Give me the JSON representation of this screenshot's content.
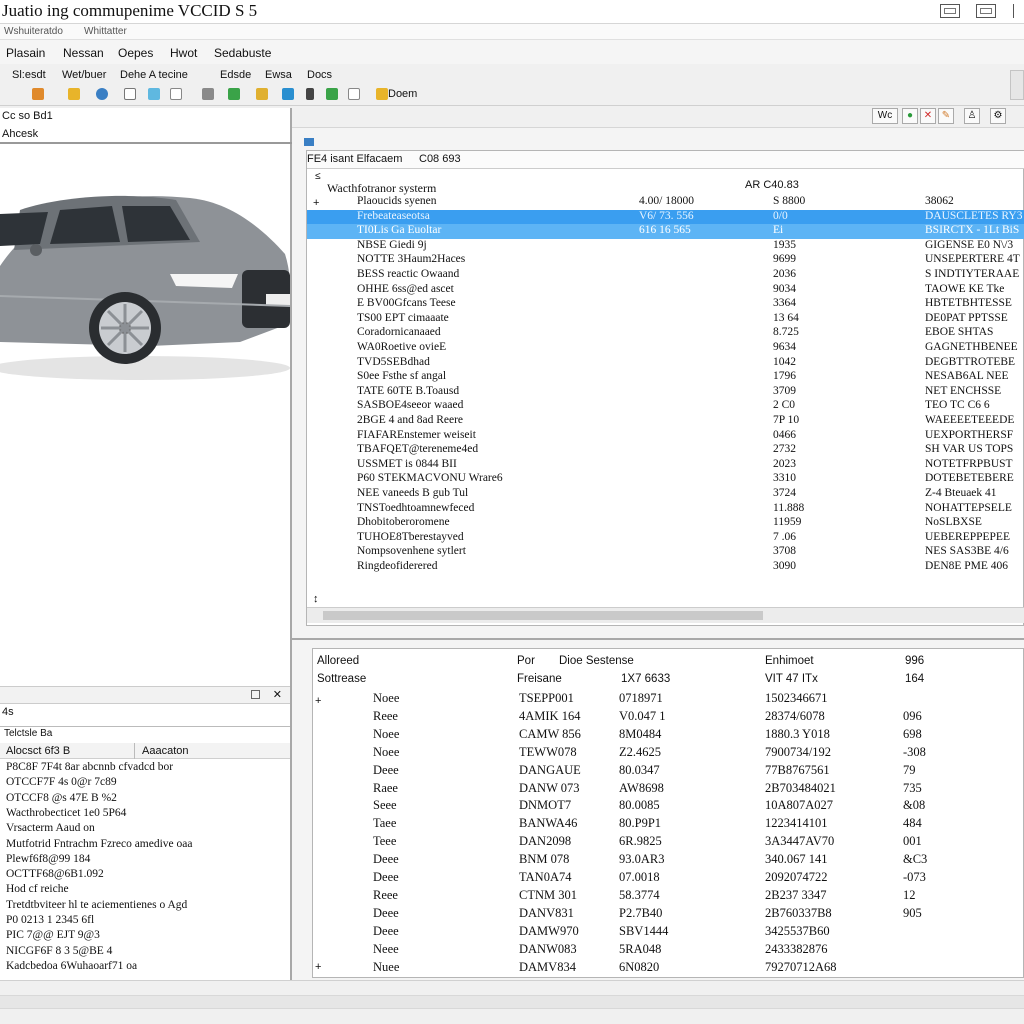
{
  "window": {
    "title": "Juatio ing commupenime VCCID S 5",
    "subtabs": [
      "Wshuiteratdo",
      "Whittatter"
    ]
  },
  "menu": [
    "Plasain",
    "Nessan",
    "Oepes",
    "Hwot",
    "Sedabuste"
  ],
  "toolbar_labels": [
    "Sl:esdt",
    "Wet/buer",
    "Dehe A tecine",
    "Edsde",
    "Ewsa",
    "Docs"
  ],
  "toolbar2": {
    "button_label": "Doem"
  },
  "left_panel": {
    "header_line1": "Cc so Bd1",
    "header_line2": "Ahcesk",
    "split_tag": "4s",
    "list_title": "Telctsle Ba",
    "list_col1": "Alocsct 6f3 B",
    "list_col2": "Aaacaton",
    "rows": [
      "P8C8F 7F4t 8ar abcnnb cfvadcd bor",
      "OTCCF7F 4s 0@r 7c89",
      "OTCCF8 @s 47E B %2",
      "Wacthrobecticet 1e0 5P64",
      "Vrsacterm Aaud on",
      "Mutfotrid Fntrachm Fzreco amedive oaa",
      "Plewf6f8@99 184",
      "OCTTF68@6B1.092",
      "Hod cf reiche",
      "Tretdtbviteer hl te aciementienes o Agd",
      "P0 0213 1 2345 6fl",
      "PIC 7@@ EJT 9@3",
      "NICGF6F 8 3 5@BE 4",
      "Kadcbedoa 6Wuhaoarf71 oa"
    ]
  },
  "top_grid": {
    "header_label": "FE4 isant Elfacaem",
    "header_code": "C08 693",
    "section_title": "Wacthfotranor systerm",
    "col_c_header": "AR C40.83",
    "right_toolbar_label": "Wc",
    "rows": [
      {
        "name": "Plaoucids syenen",
        "a": "4.00/ 18000",
        "b": "S 8800",
        "c": "38062"
      },
      {
        "name": "Frebeateaseotsa",
        "a": "V6/ 73. 556",
        "b": "0/0",
        "c": "DAUSCLETES RY3",
        "sel": true
      },
      {
        "name": "TI0Lis Ga Euoltar",
        "a": "616 16 565",
        "b": "Ei",
        "c": "BSIRCTX - 1Lt BiS",
        "sel": true
      },
      {
        "name": "NBSE Giedi 9j",
        "a": "",
        "b": "1935",
        "c": "GIGENSE E0 N\\/3"
      },
      {
        "name": "NOTTE 3Haum2Haces",
        "a": "",
        "b": "9699",
        "c": "UNSEPERTERE 4T"
      },
      {
        "name": "BESS reactic Owaand",
        "a": "",
        "b": "2036",
        "c": "S INDTIYTERAAE"
      },
      {
        "name": "OHHE 6ss@ed ascet",
        "a": "",
        "b": "9034",
        "c": "TAOWE KE Tke"
      },
      {
        "name": "E BV00Gfcans Teese",
        "a": "",
        "b": "3364",
        "c": "HBTETBHTESSE"
      },
      {
        "name": "TS00 EPT cimaaate",
        "a": "",
        "b": "13 64",
        "c": "DE0PAT PPTSSE"
      },
      {
        "name": "Coradornicanaaed",
        "a": "",
        "b": "8.725",
        "c": "EBOE SHTAS"
      },
      {
        "name": "WA0Roetive ovieE",
        "a": "",
        "b": "9634",
        "c": "GAGNETHBENEE"
      },
      {
        "name": "TVD5SEBdhad",
        "a": "",
        "b": "1042",
        "c": "DEGBTTROTEBE"
      },
      {
        "name": "S0ee Fsthe sf angal",
        "a": "",
        "b": "1796",
        "c": "NESAB6AL NEE"
      },
      {
        "name": "TATE 60TE B.Toausd",
        "a": "",
        "b": "3709",
        "c": "NET ENCHSSE"
      },
      {
        "name": "SASBOE4seeor waaed",
        "a": "",
        "b": "2 C0",
        "c": "TEO TC C6 6"
      },
      {
        "name": "2BGE 4 and 8ad Reere",
        "a": "",
        "b": "7P 10",
        "c": "WAEEEETEEEDE"
      },
      {
        "name": "FIAFAREnstemer weiseit",
        "a": "",
        "b": "0466",
        "c": "UEXPORTHERSF"
      },
      {
        "name": "TBAFQET@tereneme4ed",
        "a": "",
        "b": "2732",
        "c": "SH VAR US TOPS"
      },
      {
        "name": "USSMET is 0844 BII",
        "a": "",
        "b": "2023",
        "c": "NOTETFRPBUST"
      },
      {
        "name": "P60 STEKMACVONU Wrare6",
        "a": "",
        "b": "3310",
        "c": "DOTEBETEBERE"
      },
      {
        "name": "NEE vaneeds B gub Tul",
        "a": "",
        "b": "3724",
        "c": "Z-4 Bteuaek 41"
      },
      {
        "name": "TNSToedhtoamnewfeced",
        "a": "",
        "b": "11.888",
        "c": "NOHATTEPSELE"
      },
      {
        "name": "Dhobitoberoromene",
        "a": "",
        "b": "11959",
        "c": "NoSLBXSE"
      },
      {
        "name": "TUHOE8Tberestayved",
        "a": "",
        "b": "7 .06",
        "c": "UEBEREPPEPEE"
      },
      {
        "name": "Nompsovenhene sytlert",
        "a": "",
        "b": "3708",
        "c": "NES SAS3BE 4/6"
      },
      {
        "name": "Ringdeofiderered",
        "a": "",
        "b": "3090",
        "c": "DEN8E PME 406"
      }
    ]
  },
  "bottom_grid": {
    "head1": {
      "a": "Alloreed",
      "b": "Por",
      "c": "Dioe Sestense",
      "d": "Enhimoet",
      "e": "996"
    },
    "head2": {
      "a": "Sottrease",
      "b": "Freisane",
      "c": "1X7 6633",
      "d": "VIT 47 ITx",
      "e": "164"
    },
    "rows": [
      {
        "a": "Noee",
        "b": "TSEPP001",
        "c": "0718971",
        "d": "1502346671",
        "e": ""
      },
      {
        "a": "Reee",
        "b": "4AMIK 164",
        "c": "V0.047 1",
        "d": "28374/6078",
        "e": "096"
      },
      {
        "a": "Noee",
        "b": "CAMW 856",
        "c": "8M0484",
        "d": "1880.3 Y018",
        "e": "698"
      },
      {
        "a": "Noee",
        "b": "TEWW078",
        "c": "Z2.4625",
        "d": "7900734/192",
        "e": "-308"
      },
      {
        "a": "Deee",
        "b": "DANGAUE",
        "c": "80.0347",
        "d": "77B8767561",
        "e": "79"
      },
      {
        "a": "Raee",
        "b": "DANW 073",
        "c": "AW8698",
        "d": "2B703484021",
        "e": "735"
      },
      {
        "a": "Seee",
        "b": "DNMOT7",
        "c": "80.0085",
        "d": "10A807A027",
        "e": "&08"
      },
      {
        "a": "Taee",
        "b": "BANWA46",
        "c": "80.P9P1",
        "d": "1223414101",
        "e": "484"
      },
      {
        "a": "Teee",
        "b": "DAN2098",
        "c": "6R.9825",
        "d": "3A3447AV70",
        "e": "001"
      },
      {
        "a": "Deee",
        "b": "BNM 078",
        "c": "93.0AR3",
        "d": "340.067 141",
        "e": "&C3"
      },
      {
        "a": "Deee",
        "b": "TAN0A74",
        "c": "07.0018",
        "d": "2092074722",
        "e": "-073"
      },
      {
        "a": "Reee",
        "b": "CTNM 301",
        "c": "58.3774",
        "d": "2B237 3347",
        "e": "12"
      },
      {
        "a": "Deee",
        "b": "DANV831",
        "c": "P2.7B40",
        "d": "2B760337B8",
        "e": "905"
      },
      {
        "a": "Deee",
        "b": "DAMW970",
        "c": "SBV1444",
        "d": "3425537B60",
        "e": ""
      },
      {
        "a": "Neee",
        "b": "DANW083",
        "c": "5RA048",
        "d": "2433382876",
        "e": ""
      },
      {
        "a": "Nuee",
        "b": "DAMV834",
        "c": "6N0820",
        "d": "79270712A68",
        "e": ""
      }
    ]
  },
  "colors": {
    "selection": "#3a9ef0",
    "selection_light": "#5db4f5",
    "car_body": "#8e9297"
  }
}
